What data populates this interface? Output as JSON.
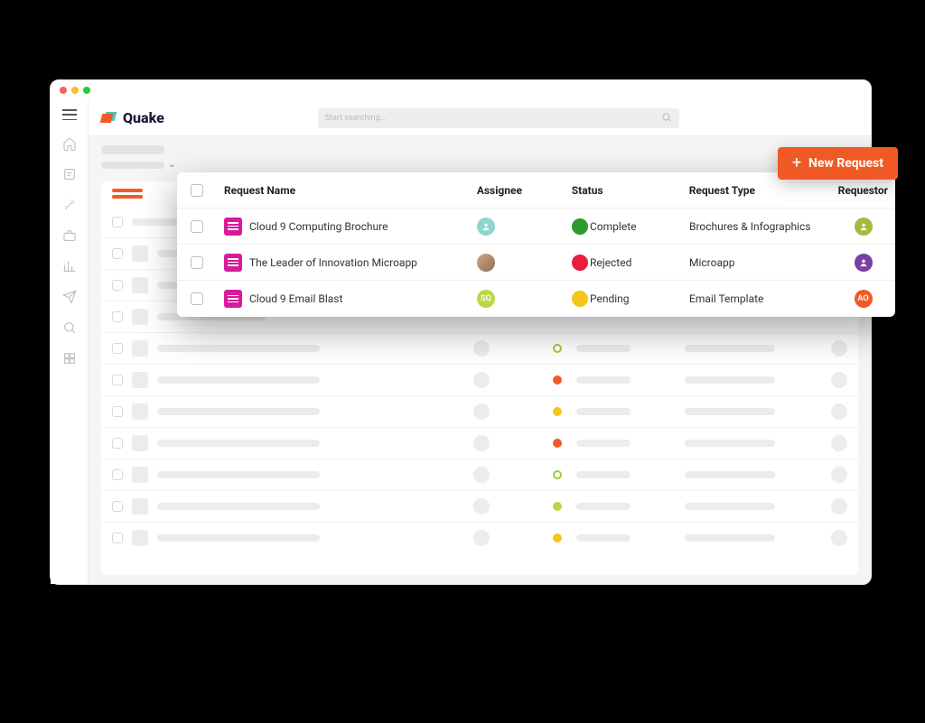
{
  "brand": {
    "name": "Quake"
  },
  "search": {
    "placeholder": "Start searching..."
  },
  "actions": {
    "new_request": "New Request"
  },
  "columns": {
    "name": "Request Name",
    "assignee": "Assignee",
    "status": "Status",
    "type": "Request Type",
    "requestor": "Requestor"
  },
  "rows": [
    {
      "name": "Cloud 9 Computing Brochure",
      "assignee": {
        "kind": "icon",
        "bg": "#8fd4d1"
      },
      "status": {
        "label": "Complete",
        "color": "#2e9a2e"
      },
      "type": "Brochures & Infographics",
      "requestor": {
        "kind": "icon",
        "bg": "#a8b83d"
      }
    },
    {
      "name": "The Leader of Innovation Microapp",
      "assignee": {
        "kind": "photo"
      },
      "status": {
        "label": "Rejected",
        "color": "#e81e3d"
      },
      "type": "Microapp",
      "requestor": {
        "kind": "icon",
        "bg": "#7b3fa0"
      }
    },
    {
      "name": "Cloud 9 Email Blast",
      "assignee": {
        "kind": "initials",
        "initials": "SQ",
        "bg": "#b8d943"
      },
      "status": {
        "label": "Pending",
        "color": "#f5c518"
      },
      "type": "Email Template",
      "requestor": {
        "kind": "initials",
        "initials": "AO",
        "bg": "#f15a24"
      }
    }
  ],
  "ghost_status_dots": [
    "ring",
    "orange",
    "yellow",
    "orange",
    "ring",
    "lime",
    "yellow"
  ]
}
